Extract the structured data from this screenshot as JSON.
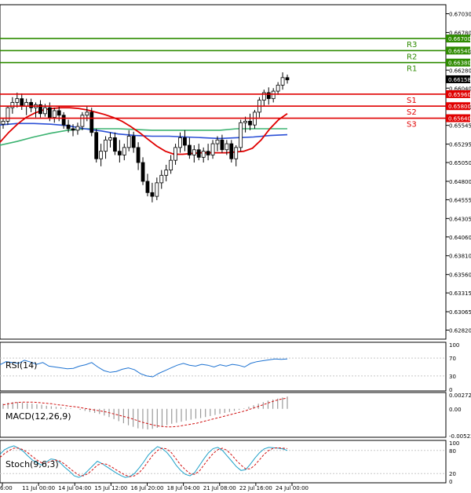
{
  "chart_data": {
    "type": "candlestick",
    "colors": {
      "grid": "#c8c8c8",
      "resistance": "#2e8b00",
      "support": "#e00000",
      "ma_red": "#e00000",
      "ma_green": "#3cb371",
      "ma_blue": "#2a4fd6",
      "rsi": "#1e73d2",
      "macd_hist": "#9a9a9a",
      "macd_signal": "#d01010",
      "stoch_main": "#1ea0c8",
      "stoch_signal": "#d01010"
    },
    "main": {
      "ylim": [
        0.627,
        0.6715
      ],
      "y_ticks": [
        "0.67030",
        "0.66780",
        "0.66530",
        "0.66280",
        "0.66040",
        "0.65790",
        "0.65545",
        "0.65295",
        "0.65050",
        "0.64800",
        "0.64555",
        "0.64305",
        "0.64060",
        "0.63810",
        "0.63560",
        "0.63315",
        "0.63065",
        "0.62820"
      ],
      "last_price": "0.66158",
      "levels": [
        {
          "name": "R3",
          "price": 0.667,
          "label": "0.66700",
          "kind": "resistance"
        },
        {
          "name": "R2",
          "price": 0.6654,
          "label": "0.66540",
          "kind": "resistance"
        },
        {
          "name": "R1",
          "price": 0.6638,
          "label": "0.66380",
          "kind": "resistance"
        },
        {
          "name": "S1",
          "price": 0.6596,
          "label": "0.65960",
          "kind": "support"
        },
        {
          "name": "S2",
          "price": 0.658,
          "label": "0.65800",
          "kind": "support"
        },
        {
          "name": "S3",
          "price": 0.6564,
          "label": "0.65640",
          "kind": "support"
        }
      ],
      "candles": [
        [
          0.6556,
          0.6563,
          0.655,
          0.656
        ],
        [
          0.656,
          0.658,
          0.6555,
          0.6578
        ],
        [
          0.6578,
          0.6592,
          0.657,
          0.6585
        ],
        [
          0.6585,
          0.6598,
          0.6578,
          0.659
        ],
        [
          0.659,
          0.6597,
          0.6575,
          0.658
        ],
        [
          0.658,
          0.659,
          0.6568,
          0.6585
        ],
        [
          0.6585,
          0.659,
          0.6572,
          0.6578
        ],
        [
          0.6578,
          0.6585,
          0.6565,
          0.6582
        ],
        [
          0.6582,
          0.6588,
          0.6565,
          0.657
        ],
        [
          0.657,
          0.6583,
          0.6566,
          0.6578
        ],
        [
          0.6578,
          0.6585,
          0.656,
          0.6565
        ],
        [
          0.6565,
          0.6578,
          0.6558,
          0.6574
        ],
        [
          0.6574,
          0.658,
          0.656,
          0.6568
        ],
        [
          0.6568,
          0.6572,
          0.655,
          0.6555
        ],
        [
          0.6555,
          0.6562,
          0.6545,
          0.655
        ],
        [
          0.655,
          0.6556,
          0.654,
          0.6548
        ],
        [
          0.6548,
          0.6558,
          0.6542,
          0.6553
        ],
        [
          0.6553,
          0.6572,
          0.6548,
          0.6568
        ],
        [
          0.6568,
          0.658,
          0.656,
          0.6572
        ],
        [
          0.6572,
          0.6578,
          0.654,
          0.6545
        ],
        [
          0.6545,
          0.655,
          0.6505,
          0.651
        ],
        [
          0.651,
          0.653,
          0.65,
          0.652
        ],
        [
          0.652,
          0.654,
          0.651,
          0.6535
        ],
        [
          0.6535,
          0.6545,
          0.6525,
          0.6538
        ],
        [
          0.6538,
          0.6545,
          0.6515,
          0.652
        ],
        [
          0.652,
          0.6535,
          0.6505,
          0.6515
        ],
        [
          0.6515,
          0.653,
          0.6508,
          0.6525
        ],
        [
          0.6525,
          0.6548,
          0.652,
          0.654
        ],
        [
          0.654,
          0.6546,
          0.6518,
          0.6525
        ],
        [
          0.6525,
          0.6532,
          0.6495,
          0.6505
        ],
        [
          0.6505,
          0.6512,
          0.6475,
          0.648
        ],
        [
          0.648,
          0.649,
          0.646,
          0.6465
        ],
        [
          0.6465,
          0.6478,
          0.6452,
          0.646
        ],
        [
          0.646,
          0.6485,
          0.6455,
          0.6478
        ],
        [
          0.6478,
          0.6495,
          0.647,
          0.6488
        ],
        [
          0.6488,
          0.6502,
          0.648,
          0.6495
        ],
        [
          0.6495,
          0.6515,
          0.649,
          0.6508
        ],
        [
          0.6508,
          0.653,
          0.6502,
          0.6525
        ],
        [
          0.6525,
          0.6545,
          0.6518,
          0.6538
        ],
        [
          0.6538,
          0.6548,
          0.652,
          0.6528
        ],
        [
          0.6528,
          0.6538,
          0.651,
          0.6515
        ],
        [
          0.6515,
          0.6528,
          0.6505,
          0.6522
        ],
        [
          0.6522,
          0.653,
          0.6508,
          0.6512
        ],
        [
          0.6512,
          0.6525,
          0.6505,
          0.652
        ],
        [
          0.652,
          0.653,
          0.6508,
          0.6515
        ],
        [
          0.6515,
          0.6535,
          0.651,
          0.653
        ],
        [
          0.653,
          0.654,
          0.652,
          0.6535
        ],
        [
          0.6535,
          0.6542,
          0.6518,
          0.6522
        ],
        [
          0.6522,
          0.6535,
          0.6515,
          0.653
        ],
        [
          0.653,
          0.6535,
          0.6505,
          0.651
        ],
        [
          0.651,
          0.6528,
          0.65,
          0.6525
        ],
        [
          0.6525,
          0.6562,
          0.652,
          0.6558
        ],
        [
          0.6558,
          0.6566,
          0.6545,
          0.656
        ],
        [
          0.656,
          0.657,
          0.6548,
          0.6555
        ],
        [
          0.6555,
          0.6575,
          0.655,
          0.6572
        ],
        [
          0.6572,
          0.6592,
          0.6565,
          0.6588
        ],
        [
          0.6588,
          0.6602,
          0.658,
          0.6598
        ],
        [
          0.6598,
          0.6605,
          0.6582,
          0.659
        ],
        [
          0.659,
          0.6604,
          0.6585,
          0.66
        ],
        [
          0.66,
          0.6612,
          0.6595,
          0.6608
        ],
        [
          0.6608,
          0.6625,
          0.6602,
          0.6618
        ],
        [
          0.6618,
          0.6622,
          0.661,
          0.6615
        ]
      ],
      "ma_red": [
        0.6532,
        0.6545,
        0.6556,
        0.6565,
        0.6571,
        0.6575,
        0.6577,
        0.6578,
        0.6578,
        0.6577,
        0.6575,
        0.6572,
        0.6569,
        0.6565,
        0.656,
        0.6553,
        0.6545,
        0.6536,
        0.6527,
        0.652,
        0.6516,
        0.6516,
        0.6517,
        0.6518,
        0.6518,
        0.6518,
        0.6518,
        0.6519,
        0.652,
        0.6524,
        0.6535,
        0.655,
        0.6562,
        0.657
      ],
      "ma_green": [
        0.6528,
        0.6533,
        0.6539,
        0.6544,
        0.6548,
        0.655,
        0.655,
        0.655,
        0.6549,
        0.6548,
        0.6548,
        0.6548,
        0.6548,
        0.6548,
        0.655,
        0.655,
        0.655,
        0.655
      ],
      "ma_blue": [
        0.6555,
        0.6557,
        0.6557,
        0.6556,
        0.6554,
        0.655,
        0.6547,
        0.6543,
        0.6541,
        0.654,
        0.654,
        0.6539,
        0.6538,
        0.6537,
        0.6538,
        0.6539,
        0.6541,
        0.6542
      ]
    },
    "rsi": {
      "label": "RSI(14)",
      "ylim": [
        0,
        100
      ],
      "y_ticks": [
        "100",
        "70",
        "30",
        "0"
      ],
      "values": [
        55,
        62,
        60,
        58,
        65,
        61,
        56,
        60,
        52,
        50,
        48,
        46,
        47,
        52,
        55,
        60,
        50,
        42,
        38,
        40,
        45,
        48,
        44,
        35,
        30,
        28,
        36,
        42,
        48,
        54,
        58,
        54,
        52,
        56,
        54,
        50,
        55,
        52,
        56,
        54,
        50,
        58,
        62,
        64,
        66,
        68,
        67,
        68
      ]
    },
    "macd": {
      "label": "MACD(12,26,9)",
      "ylim": [
        -0.00523,
        0.00272
      ],
      "y_ticks": [
        "0.00272",
        "0.00",
        "-0.00523"
      ],
      "hist": [
        0.001,
        0.0012,
        0.0013,
        0.0013,
        0.0012,
        0.0011,
        0.001,
        0.0009,
        0.0008,
        0.0006,
        0.0005,
        0.0004,
        0.0003,
        0.0002,
        0.0001,
        0.0,
        -0.0002,
        -0.0004,
        -0.0006,
        -0.0008,
        -0.001,
        -0.0013,
        -0.0016,
        -0.002,
        -0.0024,
        -0.0028,
        -0.0032,
        -0.0035,
        -0.0038,
        -0.0039,
        -0.004,
        -0.0039,
        -0.0037,
        -0.0035,
        -0.0032,
        -0.0029,
        -0.0027,
        -0.0025,
        -0.0023,
        -0.0021,
        -0.0019,
        -0.0018,
        -0.0016,
        -0.0014,
        -0.0012,
        -0.001,
        -0.0008,
        -0.0006,
        -0.0004,
        -0.0002,
        0.0001,
        0.0004,
        0.0007,
        0.001,
        0.0013,
        0.0016,
        0.0018,
        0.002,
        0.0022,
        0.0024
      ],
      "signal": [
        0.0008,
        0.001,
        0.0012,
        0.0013,
        0.0013,
        0.0013,
        0.0012,
        0.0011,
        0.001,
        0.0008,
        0.0007,
        0.0005,
        0.0004,
        0.0002,
        0.0,
        -0.0002,
        -0.0004,
        -0.0006,
        -0.0009,
        -0.0012,
        -0.0015,
        -0.0018,
        -0.0022,
        -0.0026,
        -0.0029,
        -0.0032,
        -0.0034,
        -0.0035,
        -0.0035,
        -0.0034,
        -0.0032,
        -0.003,
        -0.0028,
        -0.0025,
        -0.0022,
        -0.0019,
        -0.0016,
        -0.0013,
        -0.001,
        -0.0007,
        -0.0004,
        0.0,
        0.0004,
        0.0008,
        0.0012,
        0.0016,
        0.0019,
        0.0021
      ]
    },
    "stoch": {
      "label": "Stoch(9,6,3)",
      "ylim": [
        0,
        100
      ],
      "y_ticks": [
        "100",
        "80",
        "20",
        "0"
      ],
      "main": [
        70,
        82,
        88,
        92,
        86,
        78,
        66,
        55,
        48,
        42,
        50,
        58,
        56,
        48,
        36,
        26,
        14,
        10,
        16,
        28,
        40,
        52,
        46,
        38,
        30,
        22,
        15,
        10,
        12,
        20,
        34,
        50,
        68,
        80,
        90,
        85,
        75,
        60,
        42,
        28,
        18,
        14,
        22,
        40,
        58,
        74,
        85,
        88,
        80,
        66,
        52,
        38,
        28,
        30,
        44,
        60,
        74,
        84,
        88,
        87,
        86,
        84,
        80
      ],
      "signal": [
        62,
        72,
        80,
        86,
        86,
        82,
        74,
        64,
        55,
        48,
        47,
        52,
        55,
        52,
        44,
        34,
        24,
        16,
        14,
        20,
        30,
        42,
        46,
        44,
        38,
        30,
        23,
        16,
        12,
        14,
        22,
        35,
        52,
        68,
        80,
        86,
        84,
        74,
        58,
        42,
        30,
        20,
        18,
        26,
        42,
        58,
        72,
        82,
        86,
        80,
        68,
        54,
        42,
        32,
        32,
        42,
        56,
        70,
        80,
        86,
        87,
        86,
        85
      ]
    },
    "x_ticks": [
      "6:00",
      "11 Jul 00:00",
      "14 Jul 04:00",
      "15 Jul 12:00",
      "16 Jul 20:00",
      "18 Jul 04:00",
      "21 Jul 08:00",
      "22 Jul 16:00",
      "24 Jul 00:00"
    ]
  }
}
